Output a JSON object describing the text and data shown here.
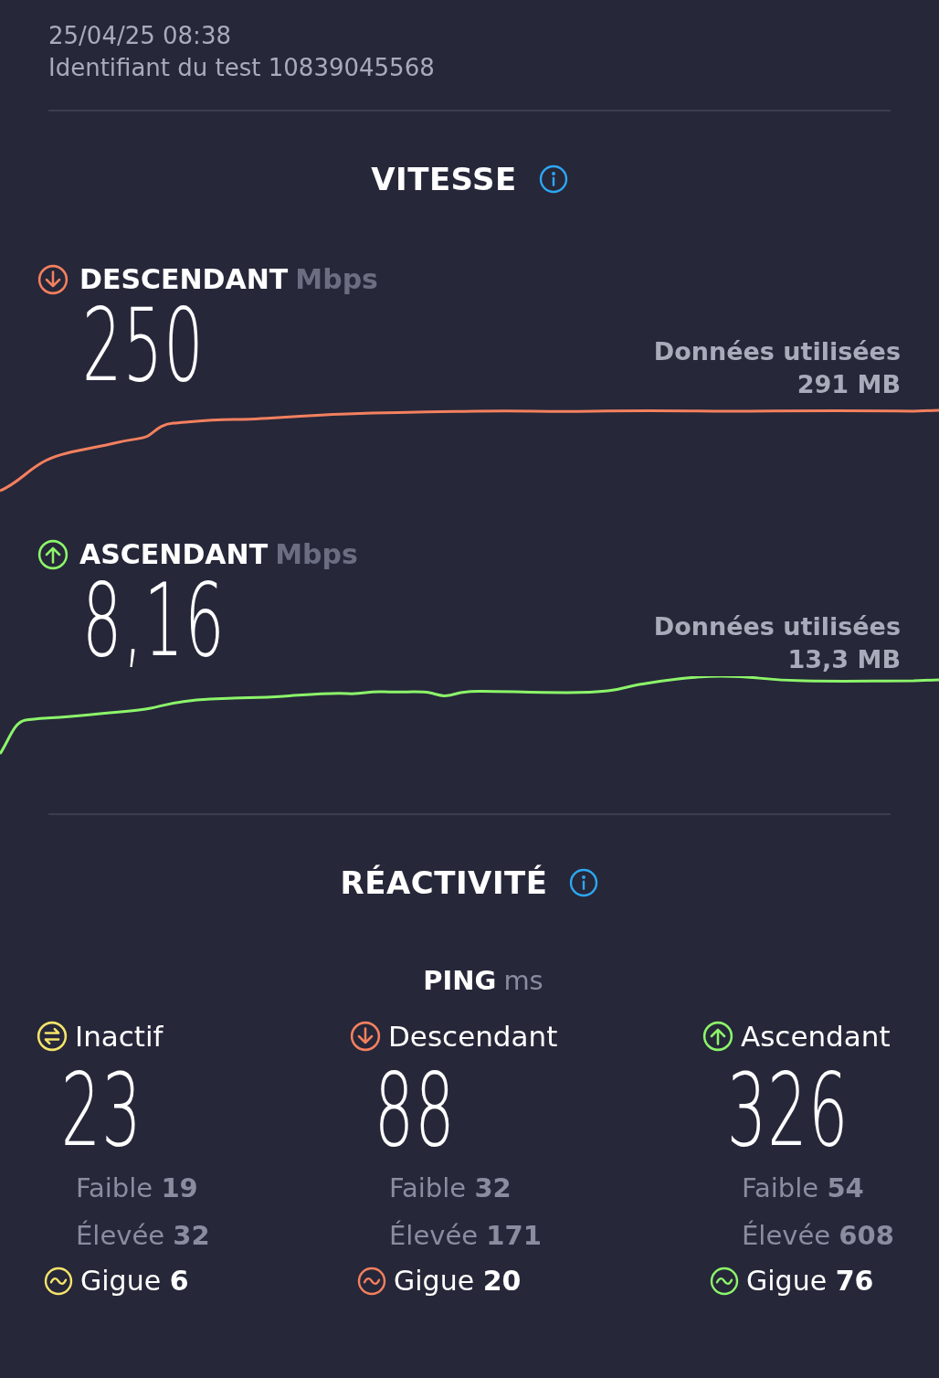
{
  "header": {
    "datetime": "25/04/25 08:38",
    "test_id": "Identifiant du test 10839045568"
  },
  "speed": {
    "title": "VITESSE",
    "tests": [
      {
        "kind": "download",
        "label": "DESCENDANT",
        "unit": "Mbps",
        "value": "250",
        "data_label": "Données utilisées",
        "data_value": "291 MB",
        "color": "#f4805f"
      },
      {
        "kind": "upload",
        "label": "ASCENDANT",
        "unit": "Mbps",
        "value": "8,16",
        "data_label": "Données utilisées",
        "data_value": "13,3 MB",
        "color": "#8cf56a"
      }
    ]
  },
  "responsiveness": {
    "title": "RÉACTIVITÉ",
    "ping_label": "PING",
    "ping_unit": "ms",
    "columns": [
      {
        "kind": "idle",
        "label": "Inactif",
        "value": "23",
        "low_label": "Faible",
        "low": "19",
        "high_label": "Élevée",
        "high": "32",
        "jitter_label": "Gigue",
        "jitter": "6",
        "color": "#f5e46a"
      },
      {
        "kind": "download",
        "label": "Descendant",
        "value": "88",
        "low_label": "Faible",
        "low": "32",
        "high_label": "Élevée",
        "high": "171",
        "jitter_label": "Gigue",
        "jitter": "20",
        "color": "#f4805f"
      },
      {
        "kind": "upload",
        "label": "Ascendant",
        "value": "326",
        "low_label": "Faible",
        "low": "54",
        "high_label": "Élevée",
        "high": "608",
        "jitter_label": "Gigue",
        "jitter": "76",
        "color": "#8cf56a"
      }
    ]
  }
}
